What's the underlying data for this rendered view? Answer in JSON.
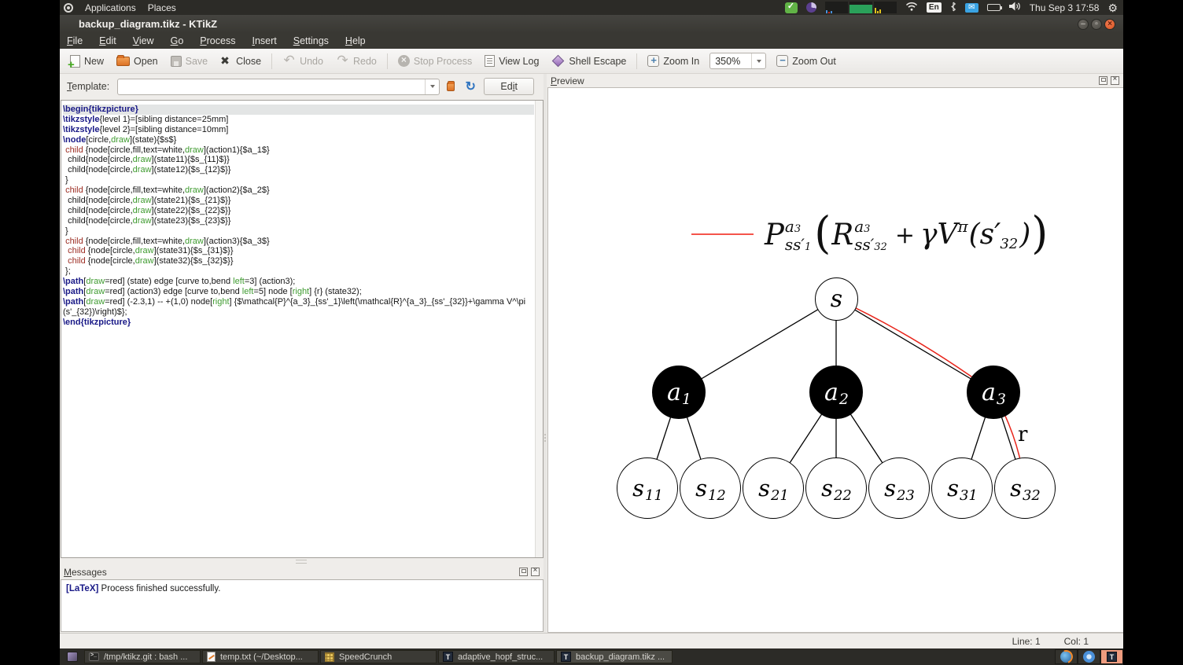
{
  "top_panel": {
    "applications_menu": "Applications",
    "places_menu": "Places",
    "keyboard_layout": "En",
    "clock": "Thu Sep 3 17:58"
  },
  "window": {
    "title": "backup_diagram.tikz - KTikZ",
    "menu_bar": {
      "file": "File",
      "edit": "Edit",
      "view": "View",
      "go": "Go",
      "process": "Process",
      "insert": "Insert",
      "settings": "Settings",
      "help": "Help"
    },
    "toolbar": {
      "new": "New",
      "open": "Open",
      "save": "Save",
      "close": "Close",
      "undo": "Undo",
      "redo": "Redo",
      "stop_process": "Stop Process",
      "view_log": "View Log",
      "shell_escape": "Shell Escape",
      "zoom_in": "Zoom In",
      "zoom_level": "350%",
      "zoom_out": "Zoom Out"
    },
    "template_row": {
      "label": "Template:",
      "value": "",
      "edit_pre": "Ed",
      "edit_accel": "i",
      "edit_post": "t"
    }
  },
  "editor": {
    "lines": [
      [
        [
          "k",
          "\\begin{tikzpicture}"
        ]
      ],
      [
        [
          "k",
          "\\tikzstyle"
        ],
        [
          "t",
          "{level 1}=[sibling distance=25mm]"
        ]
      ],
      [
        [
          "k",
          "\\tikzstyle"
        ],
        [
          "t",
          "{level 2}=[sibling distance=10mm]"
        ]
      ],
      [
        [
          "k",
          "\\node"
        ],
        [
          "t",
          "[circle,"
        ],
        [
          "g",
          "draw"
        ],
        [
          "t",
          "](state){$s$}"
        ]
      ],
      [
        [
          "t",
          " "
        ],
        [
          "r",
          "child"
        ],
        [
          "t",
          " {node[circle,fill,text=white,"
        ],
        [
          "g",
          "draw"
        ],
        [
          "t",
          "](action1){$a_1$}"
        ]
      ],
      [
        [
          "t",
          "  child{node[circle,"
        ],
        [
          "g",
          "draw"
        ],
        [
          "t",
          "](state11){$s_{11}$}}"
        ]
      ],
      [
        [
          "t",
          "  child{node[circle,"
        ],
        [
          "g",
          "draw"
        ],
        [
          "t",
          "](state12){$s_{12}$}}"
        ]
      ],
      [
        [
          "t",
          " }"
        ]
      ],
      [
        [
          "t",
          " "
        ],
        [
          "r",
          "child"
        ],
        [
          "t",
          " {node[circle,fill,text=white,"
        ],
        [
          "g",
          "draw"
        ],
        [
          "t",
          "](action2){$a_2$}"
        ]
      ],
      [
        [
          "t",
          "  child{node[circle,"
        ],
        [
          "g",
          "draw"
        ],
        [
          "t",
          "](state21){$s_{21}$}}"
        ]
      ],
      [
        [
          "t",
          "  child{node[circle,"
        ],
        [
          "g",
          "draw"
        ],
        [
          "t",
          "](state22){$s_{22}$}}"
        ]
      ],
      [
        [
          "t",
          "  child{node[circle,"
        ],
        [
          "g",
          "draw"
        ],
        [
          "t",
          "](state23){$s_{23}$}}"
        ]
      ],
      [
        [
          "t",
          " }"
        ]
      ],
      [
        [
          "t",
          " "
        ],
        [
          "r",
          "child"
        ],
        [
          "t",
          " {node[circle,fill,text=white,"
        ],
        [
          "g",
          "draw"
        ],
        [
          "t",
          "](action3){$a_3$}"
        ]
      ],
      [
        [
          "t",
          "  "
        ],
        [
          "r",
          "child"
        ],
        [
          "t",
          " {node[circle,"
        ],
        [
          "g",
          "draw"
        ],
        [
          "t",
          "](state31){$s_{31}$}}"
        ]
      ],
      [
        [
          "t",
          "  "
        ],
        [
          "r",
          "child"
        ],
        [
          "t",
          " {node[circle,"
        ],
        [
          "g",
          "draw"
        ],
        [
          "t",
          "](state32){$s_{32}$}}"
        ]
      ],
      [
        [
          "t",
          " };"
        ]
      ],
      [
        [
          "k",
          "\\path"
        ],
        [
          "t",
          "["
        ],
        [
          "g",
          "draw"
        ],
        [
          "t",
          "=red] (state) edge [curve to,bend "
        ],
        [
          "g",
          "left"
        ],
        [
          "t",
          "=3] (action3);"
        ]
      ],
      [
        [
          "k",
          "\\path"
        ],
        [
          "t",
          "["
        ],
        [
          "g",
          "draw"
        ],
        [
          "t",
          "=red] (action3) edge [curve to,bend "
        ],
        [
          "g",
          "left"
        ],
        [
          "t",
          "=5] node ["
        ],
        [
          "g",
          "right"
        ],
        [
          "t",
          "] {r} (state32);"
        ]
      ],
      [
        [
          "k",
          "\\path"
        ],
        [
          "t",
          "["
        ],
        [
          "g",
          "draw"
        ],
        [
          "t",
          "=red] (-2.3,1) -- +(1,0) node["
        ],
        [
          "g",
          "right"
        ],
        [
          "t",
          "] {$\\mathcal{P}^{a_3}_{ss'_1}\\left(\\mathcal{R}^{a_3}_{ss'_{32}}+\\gamma V^\\pi"
        ]
      ],
      [
        [
          "t",
          "(s'_{32})\\right)$};"
        ]
      ],
      [
        [
          "k",
          "\\end{tikzpicture}"
        ]
      ]
    ]
  },
  "messages": {
    "title": "Messages",
    "tag": "[LaTeX]",
    "text": " Process finished successfully."
  },
  "preview": {
    "title": "Preview",
    "formula": {
      "P": "P",
      "P_sup_base": "a",
      "P_sup_sub": "3",
      "P_sub_base": "ss′",
      "P_sub_sub": "1",
      "lparen": "(",
      "R": "R",
      "R_sup_base": "a",
      "R_sup_sub": "3",
      "R_sub_base": "ss′",
      "R_sub_sub": "32",
      "plus": "+",
      "gammaV": "γV",
      "pi": "π",
      "arg_pre": "(s′",
      "arg_sub": "32",
      "arg_post": ")",
      "rparen": ")"
    },
    "reward_label": "r",
    "nodes": {
      "root": {
        "base": "s",
        "sub": ""
      },
      "a1": {
        "base": "a",
        "sub": "1"
      },
      "a2": {
        "base": "a",
        "sub": "2"
      },
      "a3": {
        "base": "a",
        "sub": "3"
      },
      "s11": {
        "base": "s",
        "sub": "11"
      },
      "s12": {
        "base": "s",
        "sub": "12"
      },
      "s21": {
        "base": "s",
        "sub": "21"
      },
      "s22": {
        "base": "s",
        "sub": "22"
      },
      "s23": {
        "base": "s",
        "sub": "23"
      },
      "s31": {
        "base": "s",
        "sub": "31"
      },
      "s32": {
        "base": "s",
        "sub": "32"
      }
    },
    "colors": {
      "edge": "#000000",
      "highlight": "#e8241a",
      "action_fill": "#000000",
      "state_fill": "#ffffff"
    }
  },
  "status_bar": {
    "line": "Line: 1",
    "col": "Col: 1"
  },
  "taskbar": {
    "items": [
      {
        "label": "/tmp/ktikz.git : bash ..."
      },
      {
        "label": "temp.txt (~/Desktop..."
      },
      {
        "label": "SpeedCrunch"
      },
      {
        "label": "adaptive_hopf_struc..."
      },
      {
        "label": "backup_diagram.tikz ..."
      }
    ]
  }
}
